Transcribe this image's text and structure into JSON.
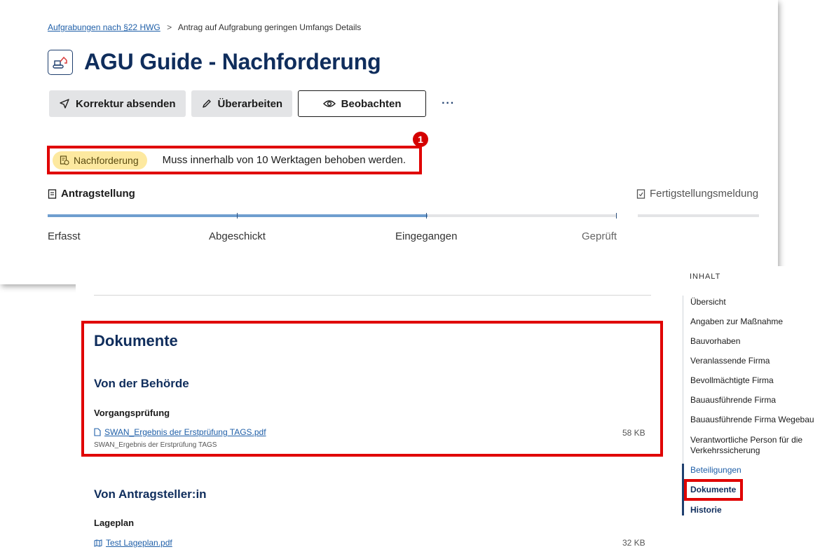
{
  "breadcrumb": {
    "link": "Aufgrabungen nach §22 HWG",
    "separator": ">",
    "current": "Antrag auf Aufgrabung geringen Umfangs Details"
  },
  "header": {
    "icon": "excavator-icon",
    "title": "AGU Guide - Nachforderung"
  },
  "actions": {
    "submit_label": "Korrektur absenden",
    "edit_label": "Überarbeiten",
    "watch_label": "Beobachten",
    "more_label": "···"
  },
  "status": {
    "badge_label": "Nachforderung",
    "message": "Muss innerhalb von 10 Werktagen behoben werden.",
    "callout_number": "1",
    "colors": {
      "pill": "#fde9a0",
      "highlight": "#e00000"
    }
  },
  "progress": {
    "section_label": "Antragstellung",
    "final_label": "Fertigstellungsmeldung",
    "filled_fraction": 0.667,
    "steps": [
      "Erfasst",
      "Abgeschickt",
      "Eingegangen",
      "Geprüft"
    ]
  },
  "documents": {
    "title": "Dokumente",
    "authority": {
      "heading": "Von der Behörde",
      "group": "Vorgangsprüfung",
      "file_name": "SWAN_Ergebnis der Erstprüfung TAGS.pdf",
      "file_desc": "SWAN_Ergebnis der Erstprüfung TAGS",
      "file_size": "58 KB"
    },
    "applicant": {
      "heading": "Von Antragsteller:in",
      "group": "Lageplan",
      "file_name": "Test Lageplan.pdf",
      "file_size": "32 KB"
    }
  },
  "toc": {
    "title": "INHALT",
    "items": [
      "Übersicht",
      "Angaben zur Maßnahme",
      "Bauvorhaben",
      "Veranlassende Firma",
      "Bevollmächtigte Firma",
      "Bauausführende Firma",
      "Bauausführende Firma Wegebau",
      "Verantwortliche Person für die Verkehrssicherung",
      "Beteiligungen",
      "Dokumente",
      "Historie"
    ]
  }
}
